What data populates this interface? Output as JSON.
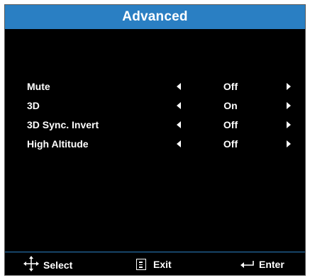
{
  "title": "Advanced",
  "items": [
    {
      "label": "Mute",
      "value": "Off"
    },
    {
      "label": "3D",
      "value": "On"
    },
    {
      "label": "3D Sync. Invert",
      "value": "Off"
    },
    {
      "label": "High Altitude",
      "value": "Off"
    }
  ],
  "footer": {
    "select_label": "Select",
    "exit_label": "Exit",
    "enter_label": "Enter",
    "select_icon": "four-way-arrows-icon",
    "exit_icon": "menu-icon",
    "enter_icon": "enter-return-icon"
  },
  "colors": {
    "accent": "#2a7fc3",
    "background": "#000000",
    "text": "#ffffff"
  }
}
